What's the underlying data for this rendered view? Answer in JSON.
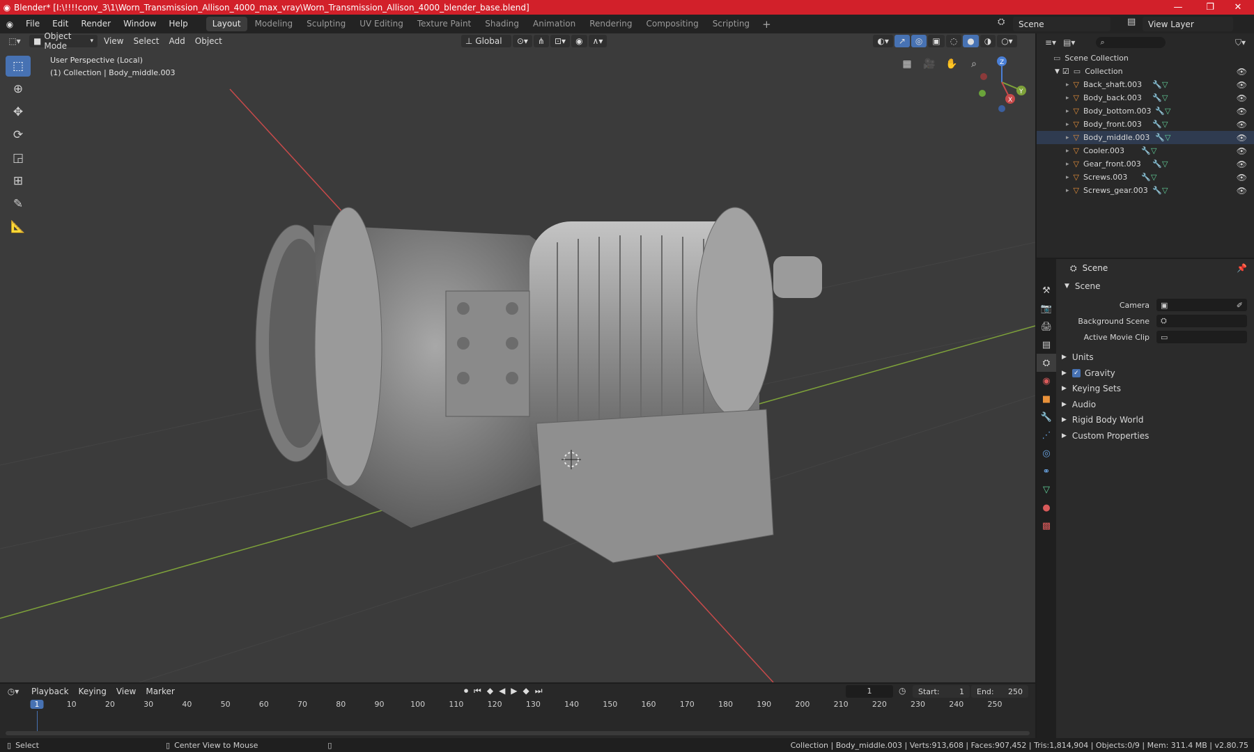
{
  "window": {
    "title": "Blender* [I:\\!!!!conv_3\\1\\Worn_Transmission_Allison_4000_max_vray\\Worn_Transmission_Allison_4000_blender_base.blend]",
    "minimize_icon": "minimize-icon",
    "maximize_icon": "restore-icon",
    "close_icon": "close-icon"
  },
  "menu": [
    "File",
    "Edit",
    "Render",
    "Window",
    "Help"
  ],
  "workspace_tabs": [
    "Layout",
    "Modeling",
    "Sculpting",
    "UV Editing",
    "Texture Paint",
    "Shading",
    "Animation",
    "Rendering",
    "Compositing",
    "Scripting"
  ],
  "active_workspace": "Layout",
  "scene_name": "Scene",
  "view_layer": "View Layer",
  "viewport": {
    "mode": "Object Mode",
    "menus": [
      "View",
      "Select",
      "Add",
      "Object"
    ],
    "transform_orientation": "Global",
    "perspective_label": "User Perspective (Local)",
    "collection_label": "(1) Collection | Body_middle.003",
    "gizmo_axes": {
      "z": "Z",
      "y": "Y",
      "x": "X"
    }
  },
  "outliner": {
    "root": "Scene Collection",
    "collection": "Collection",
    "objects": [
      "Back_shaft.003",
      "Body_back.003",
      "Body_bottom.003",
      "Body_front.003",
      "Body_middle.003",
      "Cooler.003",
      "Gear_front.003",
      "Screws.003",
      "Screws_gear.003"
    ]
  },
  "properties": {
    "header": "Scene",
    "panel_title": "Scene",
    "camera_label": "Camera",
    "background_scene_label": "Background Scene",
    "active_movie_clip_label": "Active Movie Clip",
    "sections": [
      "Units",
      "Gravity",
      "Keying Sets",
      "Audio",
      "Rigid Body World",
      "Custom Properties"
    ],
    "gravity_checked": true
  },
  "timeline": {
    "menus": [
      "Playback",
      "Keying",
      "View",
      "Marker"
    ],
    "current_frame": "1",
    "start_label": "Start:",
    "start": "1",
    "end_label": "End:",
    "end": "250",
    "frame_ticks": [
      "1",
      "10",
      "20",
      "30",
      "40",
      "50",
      "60",
      "70",
      "80",
      "90",
      "100",
      "110",
      "120",
      "130",
      "140",
      "150",
      "160",
      "170",
      "180",
      "190",
      "200",
      "210",
      "220",
      "230",
      "240",
      "250"
    ]
  },
  "statusbar": {
    "select": "Select",
    "center_view": "Center View to Mouse",
    "stats": "Collection | Body_middle.003 | Verts:913,608 | Faces:907,452 | Tris:1,814,904 | Objects:0/9 | Mem: 311.4 MB | v2.80.75"
  },
  "colors": {
    "title_bar": "#d2202a",
    "accent": "#4772b3",
    "viewport_bg": "#3b3b3b",
    "x_axis": "#c84a4a",
    "y_axis": "#7ea23a"
  }
}
